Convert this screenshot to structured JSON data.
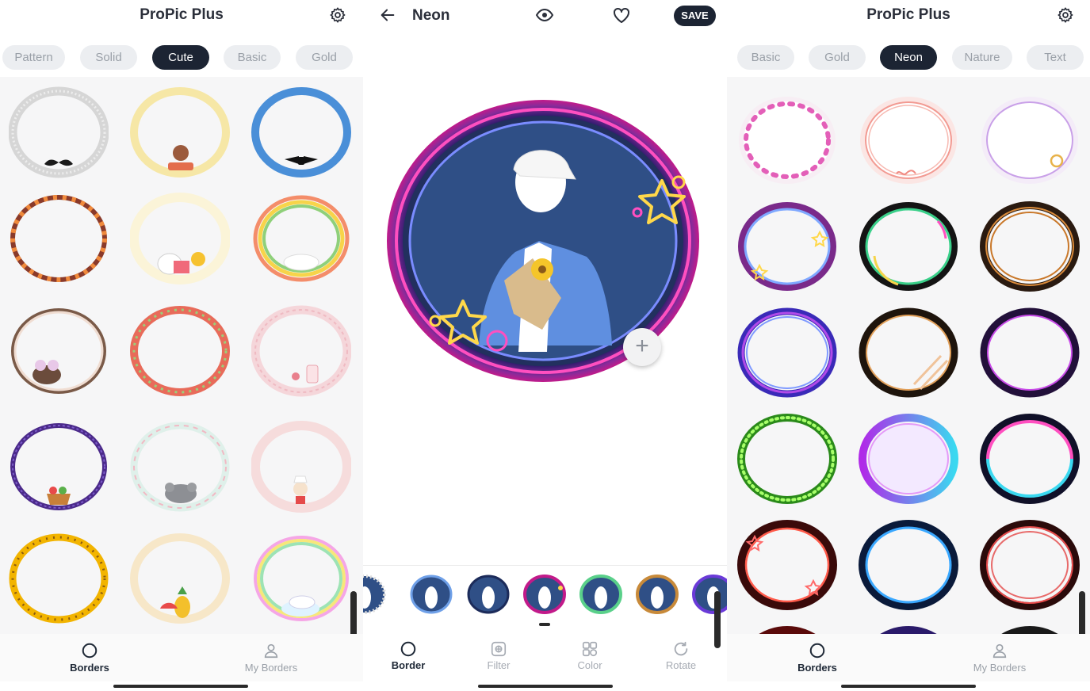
{
  "left_screen": {
    "title": "ProPic Plus",
    "categories": [
      {
        "label": "Pattern",
        "active": false
      },
      {
        "label": "Solid",
        "active": false
      },
      {
        "label": "Cute",
        "active": true
      },
      {
        "label": "Basic",
        "active": false
      },
      {
        "label": "Gold",
        "active": false
      }
    ],
    "border_styles": [
      "gray-mustache-frame",
      "yellow-banner-man-frame",
      "blue-bowtie-frame",
      "orange-candy-frame",
      "cream-bear-gift-frame",
      "rainbow-unicorn-frame",
      "brown-bunny-frame",
      "red-berry-frame",
      "pink-gingham-frame",
      "purple-basket-frame",
      "mint-koala-frame",
      "pink-chef-frame",
      "yellow-dots-frame",
      "cream-pineapple-frame",
      "rainbow-cat-frame"
    ],
    "nav": {
      "borders": "Borders",
      "my_borders": "My Borders"
    }
  },
  "middle_screen": {
    "title": "Neon",
    "save_label": "SAVE",
    "add_symbol": "+",
    "thumbnails": [
      "dotted-frame",
      "blue-frame",
      "navy-frame",
      "neon-star-frame",
      "gradient-frame",
      "gold-frame",
      "violet-frame"
    ],
    "tools": [
      {
        "label": "Border",
        "active": true,
        "icon": "circle-icon"
      },
      {
        "label": "Filter",
        "active": false,
        "icon": "filter-icon"
      },
      {
        "label": "Color",
        "active": false,
        "icon": "palette-icon"
      },
      {
        "label": "Rotate",
        "active": false,
        "icon": "rotate-icon"
      }
    ]
  },
  "right_screen": {
    "title": "ProPic Plus",
    "categories": [
      {
        "label": "Basic",
        "active": false
      },
      {
        "label": "Gold",
        "active": false
      },
      {
        "label": "Neon",
        "active": true
      },
      {
        "label": "Nature",
        "active": false
      },
      {
        "label": "Text",
        "active": false
      }
    ],
    "border_styles": [
      "pink-hearts-neon",
      "love-neon",
      "lilac-neon",
      "purple-star-neon",
      "rainbow-neon",
      "bronze-neon",
      "violet-blue-neon",
      "gold-slash-neon",
      "dark-violet-neon",
      "green-dots-neon",
      "magenta-cyan-neon",
      "pink-cyan-neon",
      "red-star-neon",
      "blue-ring-neon",
      "red-double-neon"
    ],
    "nav": {
      "borders": "Borders",
      "my_borders": "My Borders"
    }
  },
  "colors": {
    "accent_dark": "#1c2433",
    "chip_inactive_bg": "#eceef1",
    "chip_inactive_text": "#9aa0a8",
    "neon_pink": "#ff3fb4",
    "neon_blue": "#6a7bff",
    "neon_yellow": "#ffd84a"
  }
}
